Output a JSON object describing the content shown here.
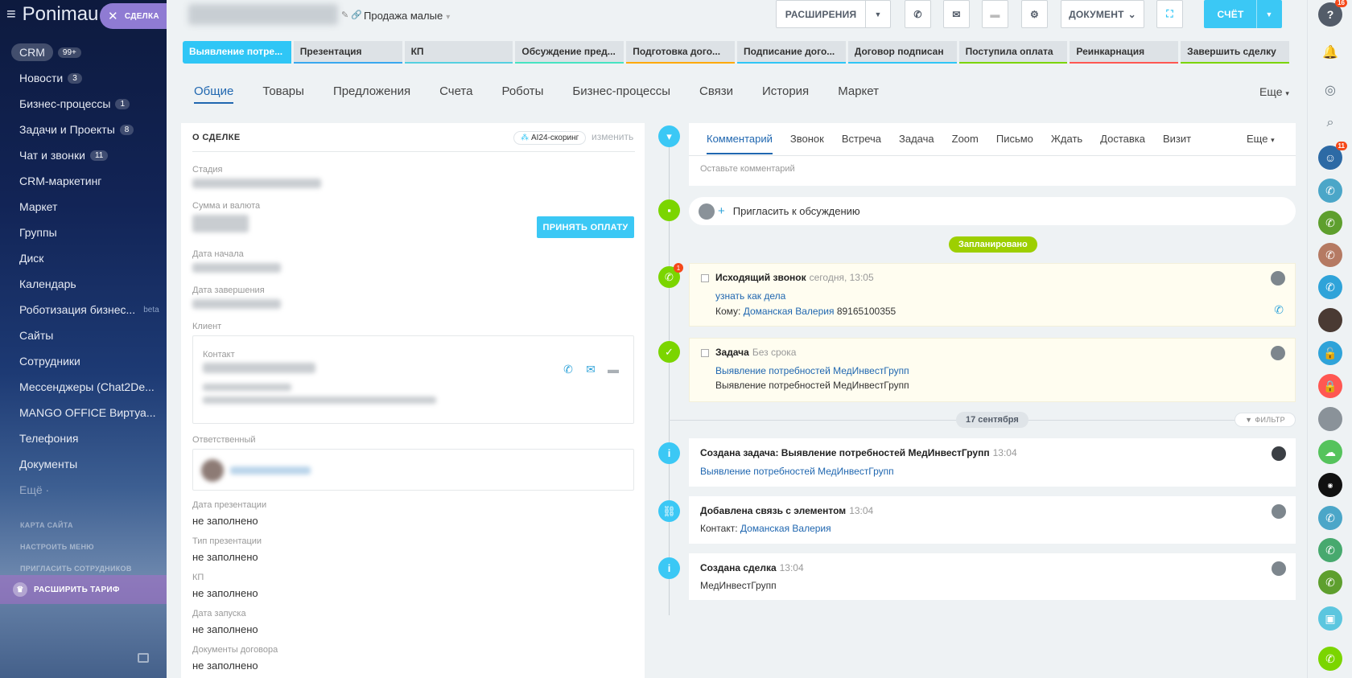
{
  "sidebar": {
    "brand": "Ponimau",
    "deal_tag": "СДЕЛКА",
    "items": [
      {
        "label": "CRM",
        "count": "99+"
      },
      {
        "label": "Новости",
        "count": "3"
      },
      {
        "label": "Бизнес-процессы",
        "count": "1"
      },
      {
        "label": "Задачи и Проекты",
        "count": "8"
      },
      {
        "label": "Чат и звонки",
        "count": "11"
      },
      {
        "label": "CRM-маркетинг"
      },
      {
        "label": "Маркет"
      },
      {
        "label": "Группы"
      },
      {
        "label": "Диск"
      },
      {
        "label": "Календарь"
      },
      {
        "label": "Роботизация бизнес...",
        "beta": "beta"
      },
      {
        "label": "Сайты"
      },
      {
        "label": "Сотрудники"
      },
      {
        "label": "Мессенджеры (Chat2De..."
      },
      {
        "label": "MANGO OFFICE Виртуа..."
      },
      {
        "label": "Телефония"
      },
      {
        "label": "Документы"
      },
      {
        "label": "Ещё ·"
      }
    ],
    "links": [
      "КАРТА САЙТА",
      "НАСТРОИТЬ МЕНЮ",
      "ПРИГЛАСИТЬ СОТРУДНИКОВ"
    ],
    "upgrade": "РАСШИРИТЬ ТАРИФ"
  },
  "header": {
    "category": "Продажа малые",
    "extensions": "РАСШИРЕНИЯ",
    "document": "ДОКУМЕНТ",
    "invoice": "СЧЁТ"
  },
  "stages": [
    {
      "label": "Выявление потре...",
      "color": "#2fc6f6"
    },
    {
      "label": "Презентация",
      "color": "#39a8ef"
    },
    {
      "label": "КП",
      "color": "#55d0e0"
    },
    {
      "label": "Обсуждение пред...",
      "color": "#47e4c2"
    },
    {
      "label": "Подготовка дого...",
      "color": "#ffa900"
    },
    {
      "label": "Подписание дого...",
      "color": "#2fc6f6"
    },
    {
      "label": "Договор подписан",
      "color": "#2fc6f6"
    },
    {
      "label": "Поступила оплата",
      "color": "#7bd500"
    },
    {
      "label": "Реинкарнация",
      "color": "#ff5752"
    },
    {
      "label": "Завершить сделку",
      "color": "#7bd500"
    }
  ],
  "tabs": [
    "Общие",
    "Товары",
    "Предложения",
    "Счета",
    "Роботы",
    "Бизнес-процессы",
    "Связи",
    "История",
    "Маркет"
  ],
  "tabs_more": "Еще",
  "deal": {
    "header": "О СДЕЛКЕ",
    "ai_chip": "AI24-скоринг",
    "change": "изменить",
    "stage_label": "Стадия",
    "sum_label": "Сумма и валюта",
    "accept_btn": "ПРИНЯТЬ ОПЛАТУ",
    "start_label": "Дата начала",
    "end_label": "Дата завершения",
    "client_label": "Клиент",
    "contact_label": "Контакт",
    "responsible_label": "Ответственный",
    "fields": [
      {
        "label": "Дата презентации",
        "value": "не заполнено"
      },
      {
        "label": "Тип презентации",
        "value": "не заполнено"
      },
      {
        "label": "КП",
        "value": "не заполнено"
      },
      {
        "label": "Дата запуска",
        "value": "не заполнено"
      },
      {
        "label": "Документы договора",
        "value": "не заполнено"
      }
    ]
  },
  "editor": {
    "tabs": [
      "Комментарий",
      "Звонок",
      "Встреча",
      "Задача",
      "Zoom",
      "Письмо",
      "Ждать",
      "Доставка",
      "Визит"
    ],
    "more": "Еще",
    "placeholder": "Оставьте комментарий"
  },
  "invite": "Пригласить к обсуждению",
  "planned": "Запланировано",
  "call": {
    "title": "Исходящий звонок",
    "time": "сегодня, 13:05",
    "subject": "узнать как дела",
    "to_label": "Кому:",
    "to_name": "Доманская Валерия",
    "phone": "89165100355",
    "badge": "1"
  },
  "task": {
    "title": "Задача",
    "deadline": "Без срока",
    "link": "Выявление потребностей МедИнвестГрупп",
    "text": "Выявление потребностей МедИнвестГрупп"
  },
  "date_sep": "17 сентября",
  "filter": "ФИЛЬТР",
  "history": [
    {
      "title": "Создана задача: Выявление потребностей МедИнвестГрупп",
      "time": "13:04",
      "link": "Выявление потребностей МедИнвестГрупп"
    },
    {
      "title": "Добавлена связь с элементом",
      "time": "13:04",
      "label": "Контакт:",
      "link": "Доманская Валерия"
    },
    {
      "title": "Создана сделка",
      "time": "13:04",
      "text": "МедИнвестГрупп"
    }
  ],
  "rightbar": {
    "help_badge": "16",
    "chat_badge": "11"
  }
}
